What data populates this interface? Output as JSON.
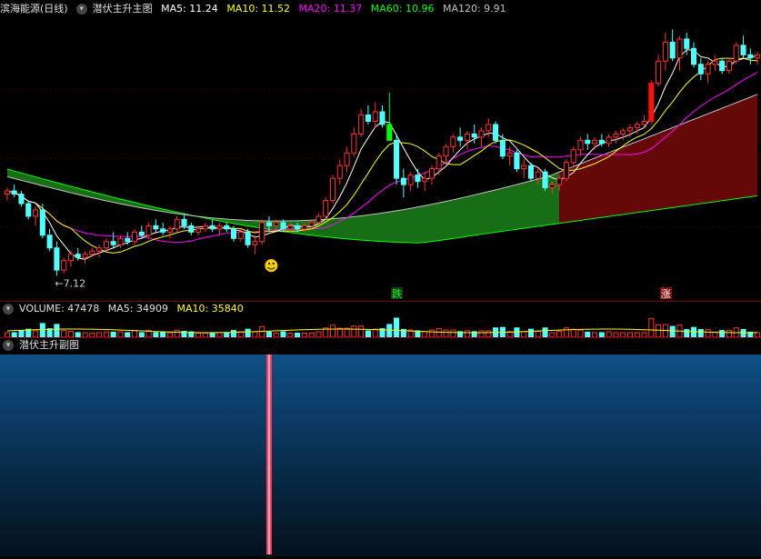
{
  "main_header": {
    "stock_name": "滨海能源(日线)",
    "indicator_name": "潜伏主升主图",
    "ma5": "MA5: 11.24",
    "ma10": "MA10: 11.52",
    "ma20": "MA20: 11.37",
    "ma60": "MA60: 10.96",
    "ma120": "MA120: 9.91"
  },
  "volume_header": {
    "label": "VOLUME: 47478",
    "ma5": "MA5: 34909",
    "ma10": "MA10: 35840"
  },
  "sub_header": {
    "label": "潜伏主升副图"
  },
  "annotations": {
    "low_price": "7.12",
    "fall_signal": "跌",
    "rise_signal": "涨",
    "smiley_signal": "☻"
  },
  "colors": {
    "up": "#ff3232",
    "down": "#54ffff",
    "ma5": "#ffffff",
    "ma10": "#ffff00",
    "ma20": "#ff00ff",
    "ma60": "#00ff00",
    "ma120": "#c0c0c0",
    "band_green": "#1a7a1a",
    "band_red": "#6a0808",
    "sub_panel": "#0f4f86"
  },
  "chart_data": {
    "type": "candlestick",
    "title": "滨海能源(日线)",
    "candles_ohlc": [
      [
        9.7,
        9.9,
        9.5,
        9.8
      ],
      [
        9.8,
        10.0,
        9.6,
        9.7
      ],
      [
        9.7,
        9.8,
        9.3,
        9.4
      ],
      [
        9.4,
        9.5,
        8.9,
        9.0
      ],
      [
        9.0,
        9.3,
        8.7,
        9.2
      ],
      [
        9.2,
        9.4,
        8.3,
        8.4
      ],
      [
        8.4,
        8.6,
        7.9,
        8.0
      ],
      [
        8.0,
        8.2,
        7.12,
        7.3
      ],
      [
        7.3,
        7.7,
        7.2,
        7.6
      ],
      [
        7.6,
        7.9,
        7.4,
        7.8
      ],
      [
        7.8,
        8.0,
        7.6,
        7.7
      ],
      [
        7.7,
        7.9,
        7.5,
        7.8
      ],
      [
        7.8,
        8.0,
        7.7,
        7.9
      ],
      [
        7.9,
        8.1,
        7.7,
        8.0
      ],
      [
        8.0,
        8.3,
        7.9,
        8.2
      ],
      [
        8.2,
        8.5,
        8.0,
        8.1
      ],
      [
        8.1,
        8.4,
        8.0,
        8.3
      ],
      [
        8.3,
        8.5,
        8.1,
        8.2
      ],
      [
        8.2,
        8.6,
        8.1,
        8.5
      ],
      [
        8.5,
        8.7,
        8.3,
        8.4
      ],
      [
        8.4,
        8.8,
        8.3,
        8.7
      ],
      [
        8.7,
        8.9,
        8.5,
        8.6
      ],
      [
        8.6,
        8.8,
        8.4,
        8.5
      ],
      [
        8.5,
        8.7,
        8.3,
        8.6
      ],
      [
        8.6,
        9.0,
        8.5,
        8.9
      ],
      [
        8.9,
        9.1,
        8.6,
        8.7
      ],
      [
        8.7,
        8.8,
        8.4,
        8.5
      ],
      [
        8.5,
        8.7,
        8.4,
        8.6
      ],
      [
        8.6,
        8.8,
        8.5,
        8.7
      ],
      [
        8.7,
        8.9,
        8.5,
        8.6
      ],
      [
        8.6,
        8.8,
        8.4,
        8.7
      ],
      [
        8.7,
        8.8,
        8.5,
        8.6
      ],
      [
        8.6,
        8.7,
        8.2,
        8.3
      ],
      [
        8.3,
        8.6,
        8.2,
        8.5
      ],
      [
        8.5,
        8.6,
        8.0,
        8.1
      ],
      [
        8.1,
        8.4,
        7.8,
        8.2
      ],
      [
        8.2,
        8.9,
        8.1,
        8.8
      ],
      [
        8.8,
        9.0,
        8.5,
        8.7
      ],
      [
        8.7,
        8.9,
        8.6,
        8.8
      ],
      [
        8.8,
        8.9,
        8.5,
        8.6
      ],
      [
        8.6,
        8.8,
        8.5,
        8.7
      ],
      [
        8.7,
        8.8,
        8.5,
        8.6
      ],
      [
        8.6,
        8.8,
        8.5,
        8.7
      ],
      [
        8.7,
        8.9,
        8.6,
        8.8
      ],
      [
        8.8,
        9.1,
        8.7,
        9.0
      ],
      [
        9.0,
        9.6,
        8.9,
        9.5
      ],
      [
        9.5,
        10.3,
        9.4,
        10.2
      ],
      [
        10.2,
        10.8,
        10.0,
        10.6
      ],
      [
        10.6,
        11.2,
        10.4,
        11.0
      ],
      [
        11.0,
        11.8,
        10.9,
        11.6
      ],
      [
        11.6,
        12.4,
        11.5,
        12.2
      ],
      [
        12.2,
        12.5,
        11.9,
        12.0
      ],
      [
        12.0,
        12.6,
        11.8,
        12.3
      ],
      [
        12.3,
        12.5,
        11.8,
        11.9
      ],
      [
        11.9,
        12.9,
        11.5,
        11.4
      ],
      [
        11.4,
        11.6,
        10.0,
        10.2
      ],
      [
        10.2,
        10.5,
        9.6,
        10.0
      ],
      [
        10.0,
        10.4,
        9.8,
        10.3
      ],
      [
        10.3,
        10.5,
        9.9,
        10.1
      ],
      [
        10.1,
        10.4,
        9.8,
        10.2
      ],
      [
        10.2,
        10.6,
        10.0,
        10.5
      ],
      [
        10.5,
        11.0,
        10.3,
        10.9
      ],
      [
        10.9,
        11.3,
        10.7,
        11.2
      ],
      [
        11.2,
        11.6,
        11.0,
        11.5
      ],
      [
        11.5,
        11.8,
        11.2,
        11.4
      ],
      [
        11.4,
        11.7,
        11.1,
        11.6
      ],
      [
        11.6,
        11.9,
        11.3,
        11.5
      ],
      [
        11.5,
        11.8,
        11.2,
        11.7
      ],
      [
        11.7,
        12.1,
        11.5,
        11.9
      ],
      [
        11.9,
        12.0,
        11.3,
        11.4
      ],
      [
        11.4,
        11.6,
        10.8,
        10.9
      ],
      [
        10.9,
        11.2,
        10.6,
        11.0
      ],
      [
        11.0,
        11.1,
        10.4,
        10.5
      ],
      [
        10.5,
        10.8,
        10.2,
        10.6
      ],
      [
        10.6,
        10.7,
        10.1,
        10.2
      ],
      [
        10.2,
        10.5,
        10.0,
        10.4
      ],
      [
        10.4,
        10.5,
        9.8,
        9.9
      ],
      [
        9.9,
        10.1,
        9.7,
        10.0
      ],
      [
        10.0,
        10.3,
        9.8,
        10.2
      ],
      [
        10.2,
        10.8,
        10.1,
        10.7
      ],
      [
        10.7,
        11.2,
        10.6,
        11.1
      ],
      [
        11.1,
        11.5,
        10.9,
        11.4
      ],
      [
        11.4,
        11.6,
        11.1,
        11.3
      ],
      [
        11.3,
        11.5,
        11.1,
        11.4
      ],
      [
        11.4,
        11.6,
        11.2,
        11.3
      ],
      [
        11.3,
        11.6,
        11.2,
        11.5
      ],
      [
        11.5,
        11.7,
        11.3,
        11.6
      ],
      [
        11.6,
        11.8,
        11.4,
        11.7
      ],
      [
        11.7,
        11.9,
        11.5,
        11.8
      ],
      [
        11.8,
        12.0,
        11.6,
        11.9
      ],
      [
        11.9,
        12.2,
        11.8,
        12.0
      ],
      [
        12.0,
        13.3,
        11.9,
        13.2
      ],
      [
        13.2,
        14.1,
        13.1,
        13.9
      ],
      [
        13.9,
        14.8,
        13.6,
        14.5
      ],
      [
        14.5,
        14.9,
        13.9,
        14.0
      ],
      [
        14.0,
        14.7,
        13.6,
        14.6
      ],
      [
        14.6,
        14.8,
        14.1,
        14.3
      ],
      [
        14.3,
        14.5,
        13.7,
        13.8
      ],
      [
        13.8,
        14.0,
        13.3,
        13.5
      ],
      [
        13.5,
        13.9,
        13.2,
        13.8
      ],
      [
        13.8,
        14.1,
        13.6,
        13.9
      ],
      [
        13.9,
        14.0,
        13.5,
        13.6
      ],
      [
        13.6,
        14.0,
        13.5,
        13.9
      ],
      [
        13.9,
        14.5,
        13.8,
        14.4
      ],
      [
        14.4,
        14.7,
        14.0,
        14.1
      ],
      [
        14.1,
        14.3,
        13.8,
        14.0
      ],
      [
        14.0,
        14.2,
        13.8,
        14.1
      ]
    ],
    "annotations": [
      {
        "text": "←7.12",
        "x": 7,
        "y": 7.12
      },
      {
        "text": "跌",
        "x": 55
      },
      {
        "text": "涨",
        "x": 93
      }
    ],
    "ma_values_latest": {
      "MA5": 11.24,
      "MA10": 11.52,
      "MA20": 11.37,
      "MA60": 10.96,
      "MA120": 9.91
    },
    "volume": {
      "latest": 47478,
      "MA5": 34909,
      "MA10": 35840
    },
    "sub_indicator": {
      "name": "潜伏主升副图",
      "signal_bar_index": 37
    }
  }
}
